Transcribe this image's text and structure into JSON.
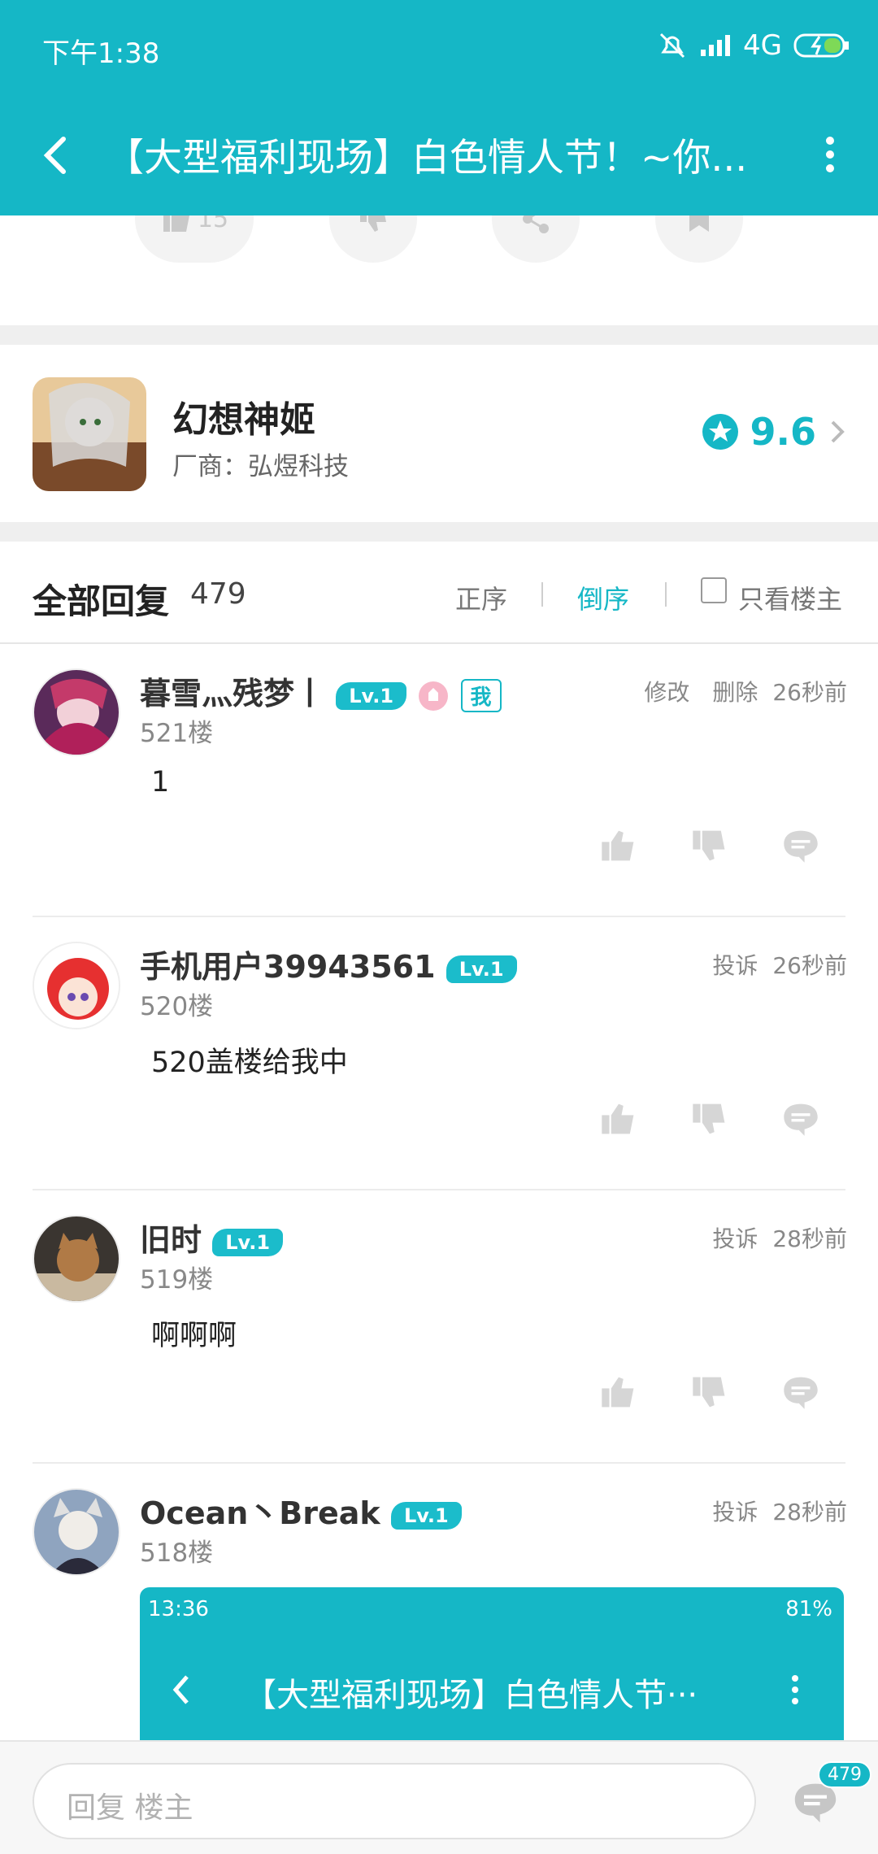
{
  "status_bar": {
    "time": "下午1:38",
    "network": "4G"
  },
  "app_bar": {
    "title": "【大型福利现场】白色情人节！~你..."
  },
  "action_strip": {
    "like_count": "15"
  },
  "game": {
    "name": "幻想神姬",
    "vendor": "厂商：弘煜科技",
    "score": "9.6"
  },
  "replies_header": {
    "label": "全部回复",
    "count": "479",
    "sort_asc": "正序",
    "sort_desc": "倒序",
    "only_author": "只看楼主"
  },
  "posts": [
    {
      "name": "暮雪灬残梦丨",
      "level": "Lv.1",
      "me": "我",
      "floor": "521楼",
      "content": "1",
      "edit": "修改",
      "delete": "删除",
      "time": "26秒前"
    },
    {
      "name": "手机用户39943561",
      "level": "Lv.1",
      "floor": "520楼",
      "content": "520盖楼给我中",
      "report": "投诉",
      "time": "26秒前"
    },
    {
      "name": "旧时",
      "level": "Lv.1",
      "floor": "519楼",
      "content": "啊啊啊",
      "report": "投诉",
      "time": "28秒前"
    },
    {
      "name": "Ocean丶Break",
      "level": "Lv.1",
      "floor": "518楼",
      "report": "投诉",
      "time": "28秒前"
    }
  ],
  "embedded_screenshot": {
    "time": "13:36",
    "battery": "81%",
    "title": "【大型福利现场】白色情人节···"
  },
  "bottom_bar": {
    "placeholder": "回复 楼主",
    "comment_count": "479"
  },
  "colors": {
    "accent": "#15b7c6"
  }
}
